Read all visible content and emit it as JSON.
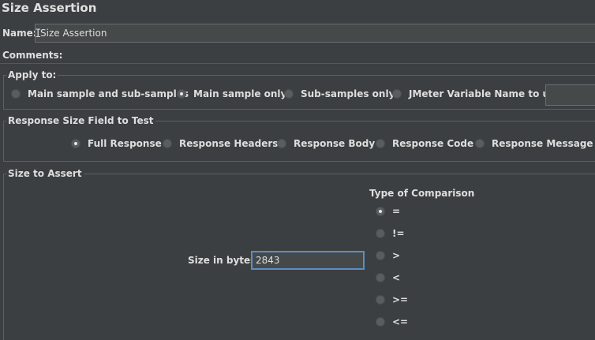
{
  "panel": {
    "title": "Size Assertion"
  },
  "name_field": {
    "label": "Name:",
    "value": "Size Assertion"
  },
  "comments_field": {
    "label": "Comments:"
  },
  "apply_to": {
    "title": "Apply to:",
    "options": [
      {
        "label": "Main sample and sub-samples",
        "selected": false
      },
      {
        "label": "Main sample only",
        "selected": true
      },
      {
        "label": "Sub-samples only",
        "selected": false
      },
      {
        "label": "JMeter Variable Name to use",
        "selected": false
      }
    ],
    "variable_name_value": ""
  },
  "response_field": {
    "title": "Response Size Field to Test",
    "options": [
      {
        "label": "Full Response",
        "selected": true
      },
      {
        "label": "Response Headers",
        "selected": false
      },
      {
        "label": "Response Body",
        "selected": false
      },
      {
        "label": "Response Code",
        "selected": false
      },
      {
        "label": "Response Message",
        "selected": false
      }
    ]
  },
  "size_to_assert": {
    "title": "Size to Assert",
    "size_label": "Size in bytes:",
    "size_value": "2843",
    "comparison_title": "Type of Comparison",
    "comparisons": [
      {
        "label": "=",
        "selected": true
      },
      {
        "label": "!=",
        "selected": false
      },
      {
        "label": ">",
        "selected": false
      },
      {
        "label": "<",
        "selected": false
      },
      {
        "label": ">=",
        "selected": false
      },
      {
        "label": "<=",
        "selected": false
      }
    ]
  }
}
